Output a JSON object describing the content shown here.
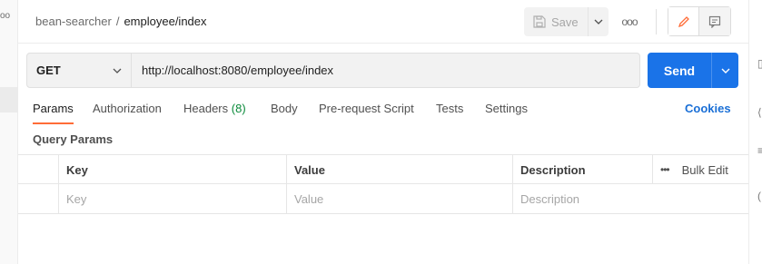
{
  "breadcrumb": {
    "collection": "bean-searcher",
    "separator": "/",
    "request": "employee/index"
  },
  "toolbar": {
    "save_label": "Save",
    "more_label": "ooo"
  },
  "request": {
    "method": "GET",
    "url": "http://localhost:8080/employee/index",
    "send_label": "Send"
  },
  "tabs": [
    {
      "label": "Params"
    },
    {
      "label": "Authorization"
    },
    {
      "label": "Headers",
      "count": "(8)"
    },
    {
      "label": "Body"
    },
    {
      "label": "Pre-request Script"
    },
    {
      "label": "Tests"
    },
    {
      "label": "Settings"
    }
  ],
  "cookies_label": "Cookies",
  "query_params": {
    "title": "Query Params",
    "headers": {
      "key": "Key",
      "value": "Value",
      "description": "Description",
      "bulk_edit": "Bulk Edit"
    },
    "placeholder_row": {
      "key": "Key",
      "value": "Value",
      "description": "Description"
    }
  },
  "colors": {
    "accent_orange": "#ff6c37",
    "send_blue": "#1a73e8",
    "cookies_blue": "#1a6fd6",
    "count_green": "#0a8a3a"
  },
  "icons": [
    "save-icon",
    "chevron-down-icon",
    "more-icon",
    "pencil-icon",
    "comment-icon"
  ]
}
